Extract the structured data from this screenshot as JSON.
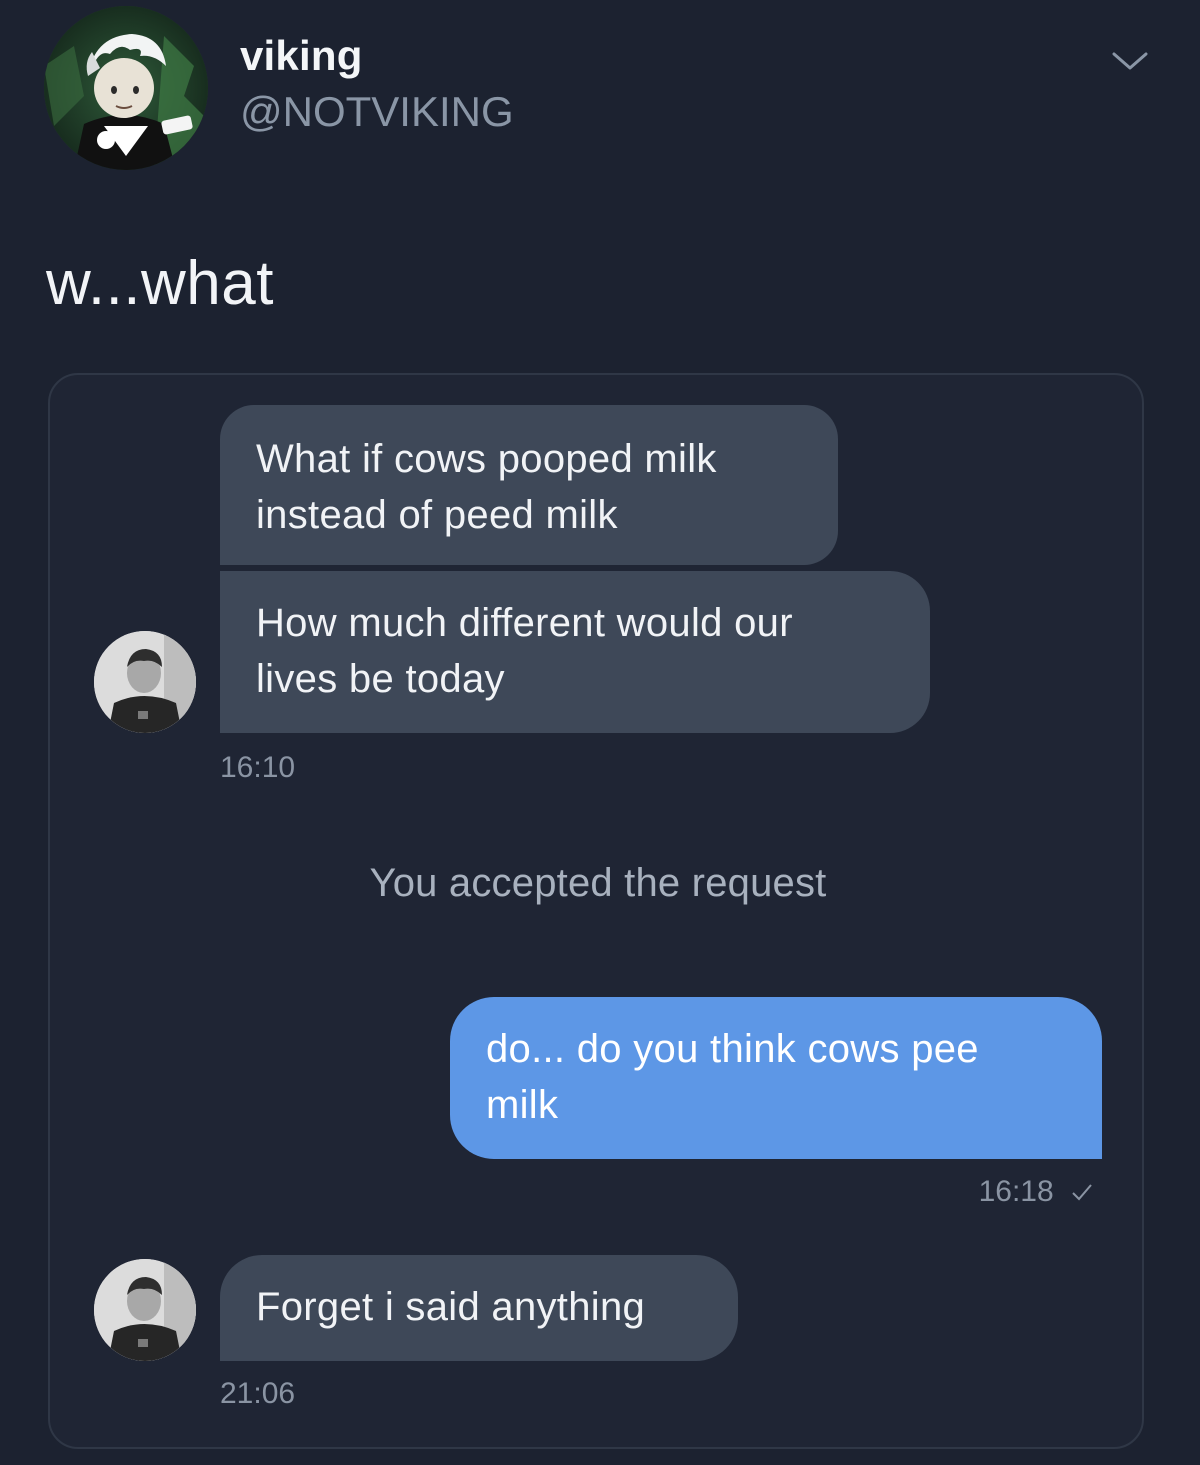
{
  "tweet": {
    "display_name": "viking",
    "handle": "@NOTVIKING",
    "text": "w...what",
    "avatar_icon": "cartoon-avatar-icon",
    "menu_icon": "chevron-down-icon"
  },
  "conversation": {
    "messages": [
      {
        "direction": "incoming",
        "text_lines": [
          "What if cows pooped milk",
          "instead of peed milk"
        ]
      },
      {
        "direction": "incoming",
        "text_lines": [
          "How much different would our",
          "lives be today"
        ]
      },
      {
        "direction": "outgoing",
        "text_lines": [
          "do... do you think cows pee",
          "milk"
        ]
      },
      {
        "direction": "incoming",
        "text_lines": [
          "Forget i said anything"
        ]
      }
    ],
    "timestamps": [
      "16:10",
      "16:18",
      "21:06"
    ],
    "system_note": "You accepted the request",
    "read_icon": "checkmark-icon"
  },
  "colors": {
    "background": "#1c2230",
    "incoming_bubble": "#3e4858",
    "outgoing_bubble": "#5d97e6",
    "muted_text": "#8a94a3"
  }
}
